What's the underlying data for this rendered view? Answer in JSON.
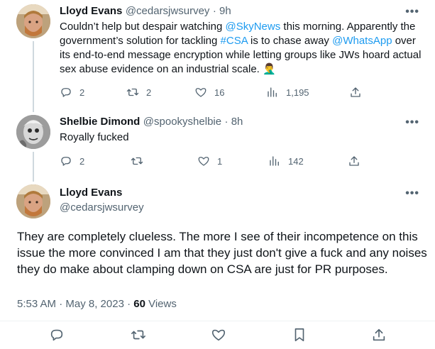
{
  "tweet1": {
    "name": "Lloyd Evans",
    "handle": "@cedarsjwsurvey",
    "time": "· 9h",
    "text_parts": [
      {
        "t": "Couldn’t help but despair watching ",
        "link": false
      },
      {
        "t": "@SkyNews",
        "link": true
      },
      {
        "t": " this morning. Apparently the government’s solution for tackling ",
        "link": false
      },
      {
        "t": "#CSA",
        "link": true
      },
      {
        "t": " is to chase away ",
        "link": false
      },
      {
        "t": "@WhatsApp",
        "link": true
      },
      {
        "t": " over its end-to-end message encryption while letting groups like JWs hoard actual sex abuse evidence on an industrial scale. 🤦‍♂️",
        "link": false
      }
    ],
    "replies": "2",
    "retweets": "2",
    "likes": "16",
    "views": "1,195"
  },
  "tweet2": {
    "name": "Shelbie Dimond",
    "handle": "@spookyshelbie",
    "time": "· 8h",
    "text": "Royally fucked",
    "replies": "2",
    "retweets": "",
    "likes": "1",
    "views": "142"
  },
  "main": {
    "name": "Lloyd Evans",
    "handle": "@cedarsjwsurvey",
    "text": "They are completely clueless. The more I see of their incompetence on this issue the more convinced I am that they just don't give a fuck and any noises they do make about clamping down on CSA are just for PR purposes.",
    "timestamp": "5:53 AM · May 8, 2023 · ",
    "views_count": "60",
    "views_label": " Views"
  },
  "more_label": "•••",
  "icons": [
    "reply-icon",
    "retweet-icon",
    "like-icon",
    "views-icon",
    "share-icon",
    "bookmark-icon"
  ]
}
